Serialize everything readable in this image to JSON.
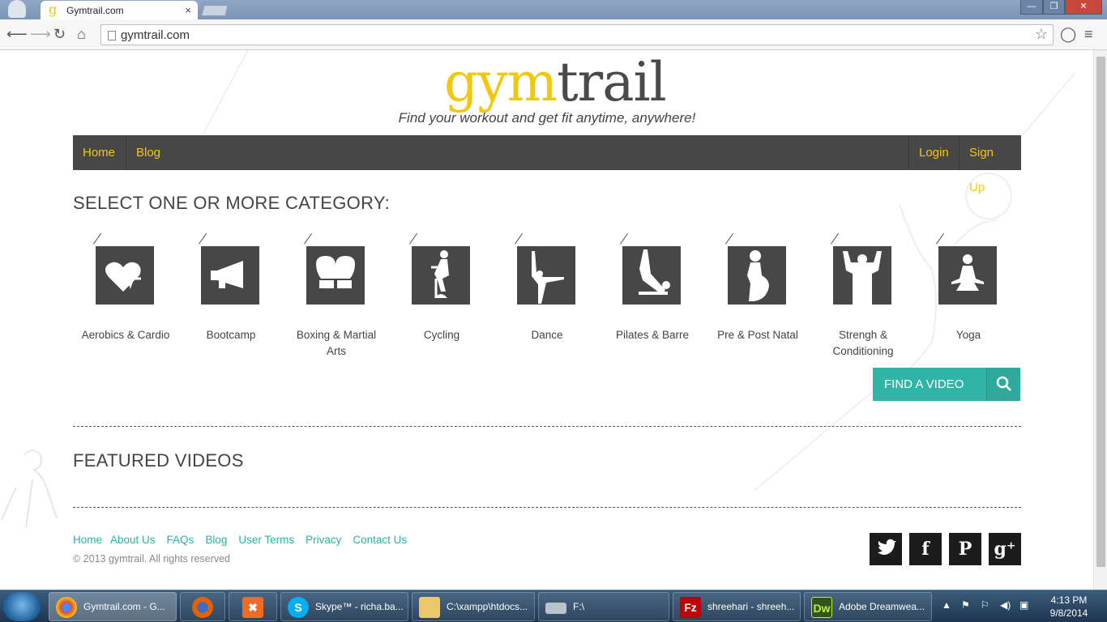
{
  "browser": {
    "tab_title": "Gymtrail.com",
    "tab_close": "×",
    "favicon_letter": "g",
    "address": "gymtrail.com",
    "window_buttons": [
      "—",
      "❐",
      "✕"
    ]
  },
  "site": {
    "logo_part1": "gym",
    "logo_part2": "trail",
    "tagline": "Find your workout and get fit anytime, anywhere!",
    "nav": {
      "home": "Home",
      "blog": "Blog",
      "login": "Login",
      "signup": "Sign Up"
    },
    "category_heading": "SELECT ONE OR MORE CATEGORY:",
    "categories": [
      {
        "label": "Aerobics & Cardio",
        "icon": "heart-pulse-icon"
      },
      {
        "label": "Bootcamp",
        "icon": "megaphone-icon"
      },
      {
        "label": "Boxing & Martial Arts",
        "icon": "boxing-gloves-icon"
      },
      {
        "label": "Cycling",
        "icon": "cyclist-icon"
      },
      {
        "label": "Dance",
        "icon": "dancer-icon"
      },
      {
        "label": "Pilates & Barre",
        "icon": "pilates-icon"
      },
      {
        "label": "Pre & Post Natal",
        "icon": "pregnant-woman-icon"
      },
      {
        "label": "Strengh & Conditioning",
        "icon": "strongman-icon"
      },
      {
        "label": "Yoga",
        "icon": "yoga-icon"
      }
    ],
    "find_button": "FIND A VIDEO",
    "featured_heading": "FEATURED VIDEOS",
    "footer_links": [
      "Home",
      "About Us",
      "FAQs",
      "Blog",
      "User Terms",
      "Privacy",
      "Contact Us"
    ],
    "copyright": "© 2013 gymtrail. All rights reserved",
    "social": [
      {
        "name": "twitter",
        "glyph": "🐦"
      },
      {
        "name": "facebook",
        "glyph": "f"
      },
      {
        "name": "pinterest",
        "glyph": "P"
      },
      {
        "name": "google-plus",
        "glyph": "g⁺"
      }
    ]
  },
  "taskbar": {
    "items": [
      {
        "label": "Gymtrail.com - G...",
        "icon": "chrome-icon"
      },
      {
        "label": "",
        "icon": "firefox-icon"
      },
      {
        "label": "",
        "icon": "xampp-icon"
      },
      {
        "label": "Skype™ - richa.ba...",
        "icon": "skype-icon"
      },
      {
        "label": "C:\\xampp\\htdocs...",
        "icon": "folder-icon"
      },
      {
        "label": "F:\\",
        "icon": "drive-icon"
      },
      {
        "label": "shreehari - shreeh...",
        "icon": "filezilla-icon"
      },
      {
        "label": "Adobe Dreamwea...",
        "icon": "dreamweaver-icon"
      }
    ],
    "time": "4:13 PM",
    "date": "9/8/2014"
  }
}
